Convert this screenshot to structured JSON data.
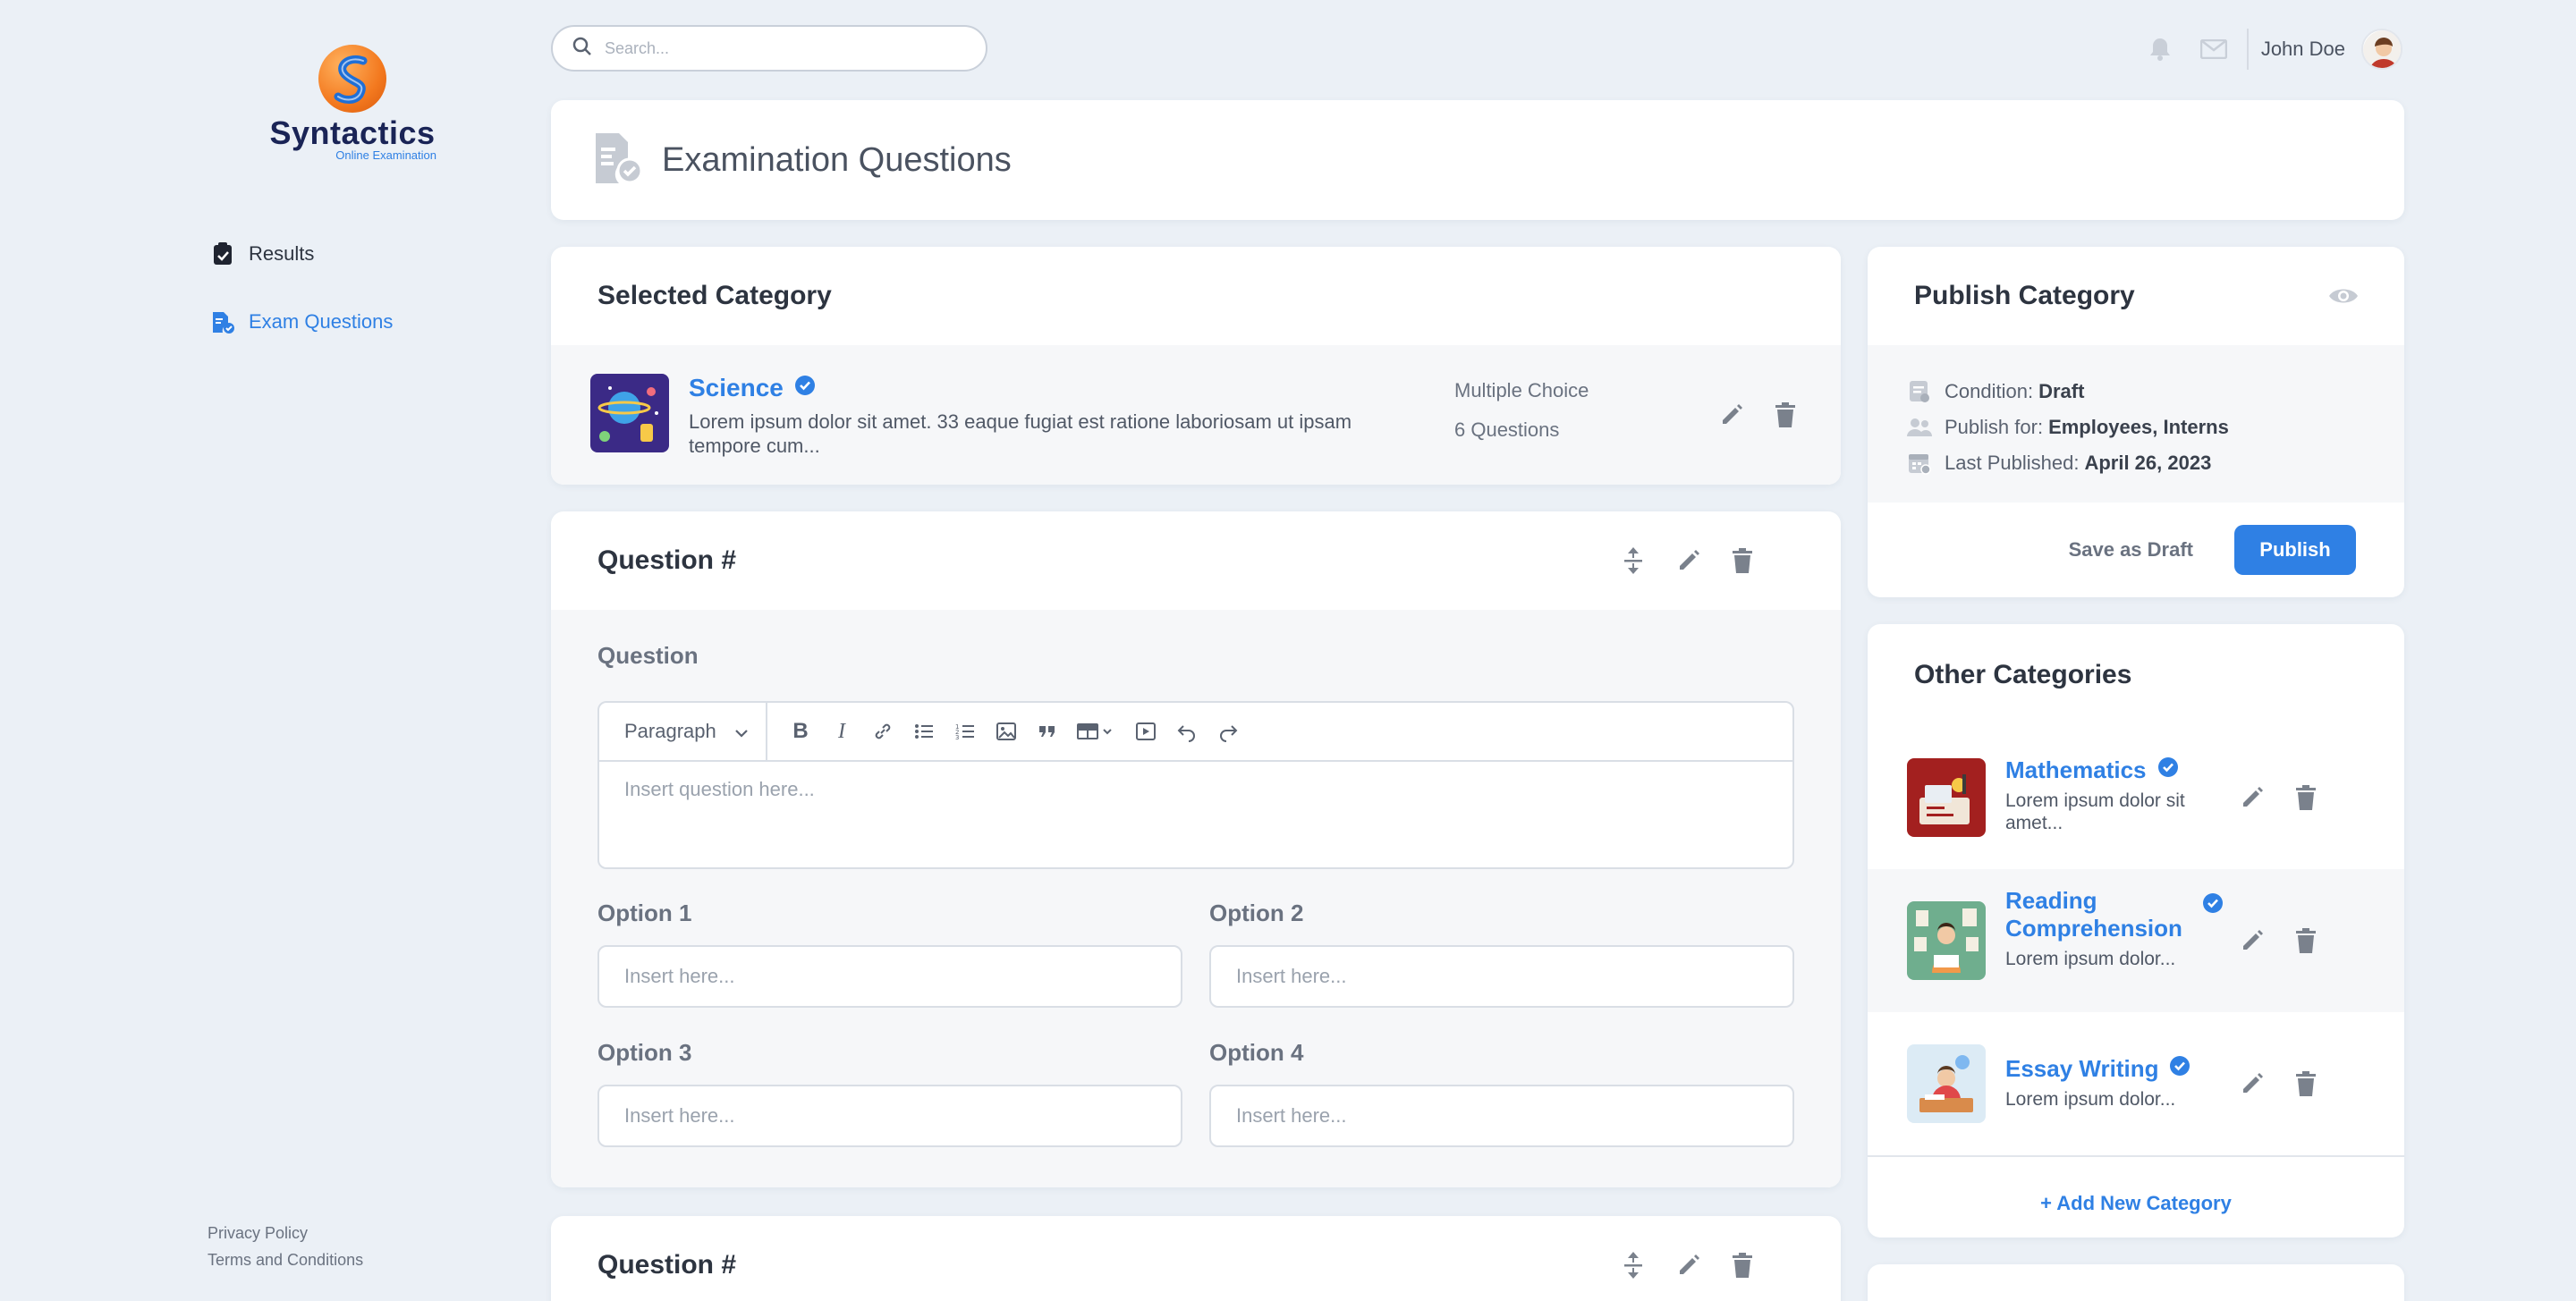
{
  "brand": {
    "name": "Syntactics",
    "tagline": "Online Examination"
  },
  "sidebar": {
    "items": [
      {
        "label": "Results",
        "icon": "clipboard-icon",
        "active": false
      },
      {
        "label": "Exam Questions",
        "icon": "document-check-icon",
        "active": true
      }
    ],
    "footer": {
      "privacy": "Privacy Policy",
      "terms": "Terms and Conditions"
    }
  },
  "topbar": {
    "search_placeholder": "Search...",
    "user_name": "John Doe"
  },
  "page": {
    "title": "Examination Questions"
  },
  "selected_category": {
    "title": "Selected Category",
    "name": "Science",
    "description": "Lorem ipsum dolor sit amet. 33 eaque fugiat est ratione laboriosam ut ipsam tempore cum...",
    "type": "Multiple Choice",
    "count": "6 Questions"
  },
  "question_card": {
    "title": "Question #",
    "question_label": "Question",
    "paragraph_label": "Paragraph",
    "question_placeholder": "Insert question here...",
    "options": [
      {
        "label": "Option 1",
        "placeholder": "Insert here..."
      },
      {
        "label": "Option 2",
        "placeholder": "Insert here..."
      },
      {
        "label": "Option 3",
        "placeholder": "Insert here..."
      },
      {
        "label": "Option 4",
        "placeholder": "Insert here..."
      }
    ]
  },
  "question_card_2": {
    "title": "Question #"
  },
  "publish": {
    "title": "Publish Category",
    "condition_label": "Condition:",
    "condition_value": "Draft",
    "for_label": "Publish for:",
    "for_value": "Employees, Interns",
    "last_label": "Last Published:",
    "last_value": "April 26, 2023",
    "save_draft": "Save as Draft",
    "publish": "Publish"
  },
  "other_categories": {
    "title": "Other Categories",
    "items": [
      {
        "name": "Mathematics",
        "description": "Lorem ipsum dolor sit amet..."
      },
      {
        "name": "Reading Comprehension",
        "name_line1": "Reading",
        "name_line2": "Comprehension",
        "description": "Lorem ipsum dolor..."
      },
      {
        "name": "Essay Writing",
        "description": "Lorem ipsum dolor..."
      }
    ],
    "add_label": "+ Add New Category"
  },
  "colors": {
    "accent": "#2f80e4",
    "background": "#ebf0f6",
    "brand_navy": "#1a2456",
    "brand_orange": "#f3791f"
  }
}
